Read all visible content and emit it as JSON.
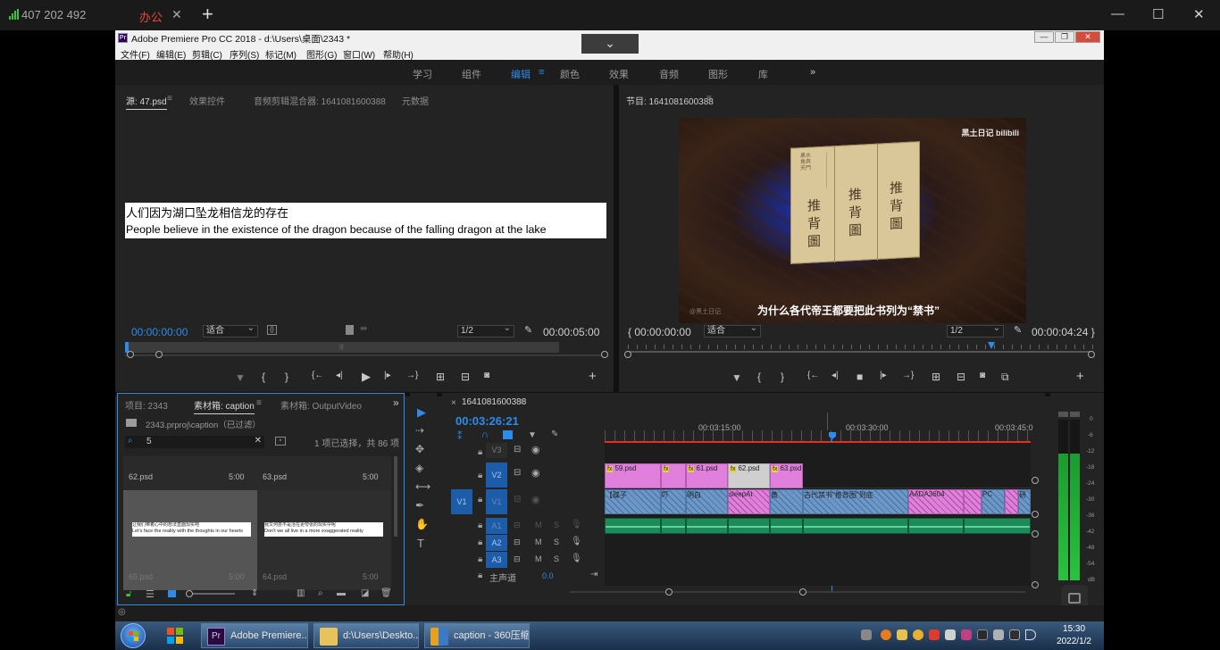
{
  "remote_bar": {
    "id_number": "407 202 492",
    "tab_label": "办公",
    "tab_close": "✕",
    "add": "+",
    "minimize": "—",
    "maximize": "☐",
    "close": "✕"
  },
  "window": {
    "title": "Adobe Premiere Pro CC 2018 - d:\\Users\\桌面\\2343 *",
    "logo": "Pr",
    "collapse_chevron": "⌄",
    "ctl_min": "—",
    "ctl_max": "❐",
    "ctl_close": "✕"
  },
  "menubar": [
    "文件(F)",
    "编辑(E)",
    "剪辑(C)",
    "序列(S)",
    "标记(M)",
    "图形(G)",
    "窗口(W)",
    "帮助(H)"
  ],
  "workspaces": {
    "items": [
      "学习",
      "组件",
      "编辑",
      "颜色",
      "效果",
      "音频",
      "图形",
      "库"
    ],
    "active": "编辑",
    "menu_icon": "≡",
    "more": "»"
  },
  "source_panel": {
    "tabs": [
      "源: 47.psd",
      "效果控件",
      "音频剪辑混合器: 1641081600388",
      "元数据"
    ],
    "tab_menu": "≡",
    "caption_cn": "人们因为湖口坠龙相信龙的存在",
    "caption_en": "People believe in the existence of the dragon because of the falling dragon at the lake",
    "timecode_in": "00:00:00:00",
    "fit": "适合",
    "scale": "1/2",
    "timecode_dur": "00:00:05:00",
    "wrench_icon": "🔧",
    "controls": [
      "▼",
      "{",
      "}",
      "{←",
      "◂|",
      "▶",
      "|▸",
      "→}",
      "⊞",
      "⊟",
      "📷"
    ],
    "add": "+"
  },
  "program_panel": {
    "title": "节目: 1641081600388",
    "tab_menu": "≡",
    "watermark_top": "黑土日记 bilibili",
    "watermark_bottom": "@黑土日记",
    "subtitle": "为什么各代帝王都要把此书列为“禁书”",
    "book_chars": [
      "推",
      "背",
      "圖"
    ],
    "timecode_in": "00:00:00:00",
    "fit": "适合",
    "scale": "1/2",
    "timecode_dur": "00:00:04:24",
    "controls": [
      "▼",
      "{",
      "}",
      "{←",
      "◂|",
      "■",
      "|▸",
      "→}",
      "⊞",
      "⊟",
      "📷",
      "⧉"
    ],
    "add": "+"
  },
  "project_panel": {
    "tabs": [
      "项目: 2343",
      "素材箱: caption",
      "素材箱: OutputVideo"
    ],
    "tab_menu": "≡",
    "more": "»",
    "path": "2343.prproj\\caption（已过滤）",
    "search_value": "5",
    "clear": "✕",
    "selection_info": "1 项已选择，共 86 项",
    "items": [
      {
        "name": "62.psd",
        "duration": "5:00",
        "cn": "让我们带着心中的想法直面现实吧",
        "en": "Let's face the reality with the thoughts in our hearts"
      },
      {
        "name": "63.psd",
        "duration": "5:00",
        "cn": "我又何尝不是活在更夸张的现实中呢",
        "en": "Don't we all live in a more exaggerated reality"
      },
      {
        "name": "65.psd",
        "duration": "5:00"
      },
      {
        "name": "64.psd",
        "duration": "5:00"
      }
    ]
  },
  "tools": [
    "▶",
    "⇢",
    "✥",
    "◈",
    "⟷",
    "✒",
    "✋",
    "T"
  ],
  "timeline": {
    "sequence": "1641081600388",
    "close": "×",
    "tab_menu": "≡",
    "timecode": "00:03:26:21",
    "ruler": [
      "00:03:15:00",
      "00:03:30:00",
      "00:03:45:0"
    ],
    "tracks_video": [
      {
        "label": "V3",
        "src": ""
      },
      {
        "label": "V2",
        "src": ""
      },
      {
        "label": "V1",
        "src": "V1"
      }
    ],
    "tracks_audio": [
      {
        "label": "A1",
        "m": "M",
        "s": "S"
      },
      {
        "label": "A2",
        "m": "M",
        "s": "S"
      },
      {
        "label": "A3",
        "m": "M",
        "s": "S"
      }
    ],
    "master": "主声道",
    "master_value": "0.0",
    "v2_clips": [
      "59.psd",
      "",
      "61.psd",
      "62.psd",
      "63.psd"
    ],
    "v1_clips": [
      "【碟子",
      "吓",
      "明白",
      "sleepAt",
      "黄",
      "古代禁书\"推背图\"到底",
      "AADA3604",
      "PC",
      "研"
    ]
  },
  "meter": {
    "scale": [
      "0",
      "-6",
      "-12",
      "-18",
      "-24",
      "-30",
      "-36",
      "-42",
      "-48",
      "-54",
      "dB"
    ]
  },
  "taskbar": {
    "buttons": [
      "Adobe Premiere...",
      "d:\\Users\\Deskto...",
      "caption - 360压缩"
    ],
    "time": "15:30",
    "date": "2022/1/2"
  },
  "colors": {
    "accent_blue": "#2d8ceb",
    "pink_clip": "#e080dc",
    "audio_green": "#1e8a5a",
    "remote_red": "#e64a3a"
  }
}
